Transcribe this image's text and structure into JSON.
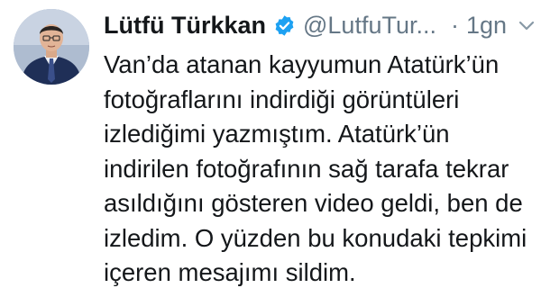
{
  "tweet": {
    "author_name": "Lütfü Türkkan",
    "handle": "@LutfuTur...",
    "separator": "·",
    "time": "1gn",
    "lines": [
      "Van’da atanan kayyumun Atatürk’ün",
      "fotoğraflarını indirdiği görüntüleri",
      "izlediğimi yazmıştım. Atatürk’ün",
      "indirilen fotoğrafının sağ tarafa tekrar",
      "asıldığını gösteren video geldi, ben de",
      "izledim. O yüzden bu konudaki tepkimi",
      "içeren mesajımı sildim."
    ]
  },
  "icons": {
    "verified": "verified-badge-icon",
    "menu": "chevron-down-icon"
  },
  "colors": {
    "text": "#14171a",
    "secondary": "#657786",
    "verified": "#1da1f2",
    "background": "#ffffff"
  }
}
